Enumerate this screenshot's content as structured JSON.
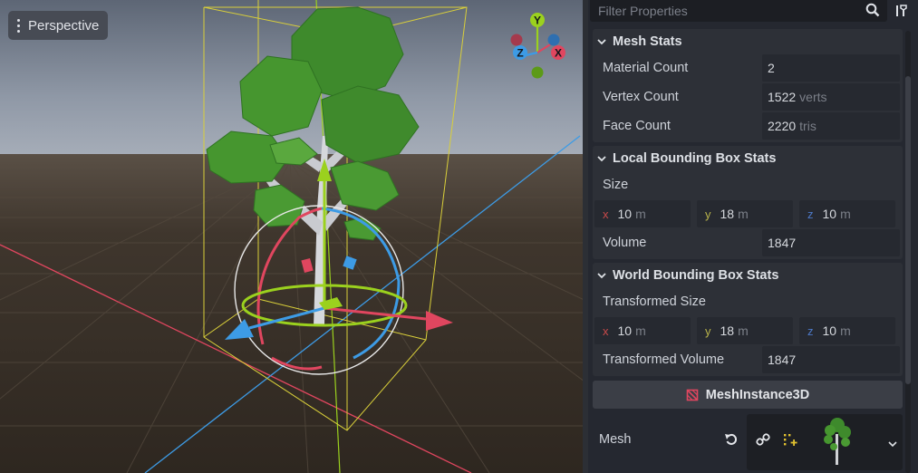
{
  "viewport": {
    "view_mode_label": "Perspective",
    "gizmo_axes": {
      "y": "Y",
      "z": "Z",
      "x": "X"
    }
  },
  "inspector": {
    "filter": {
      "placeholder": "Filter Properties"
    },
    "mesh_stats": {
      "title": "Mesh Stats",
      "rows": [
        {
          "label": "Material Count",
          "value": "2",
          "unit": ""
        },
        {
          "label": "Vertex Count",
          "value": "1522",
          "unit": "verts"
        },
        {
          "label": "Face Count",
          "value": "2220",
          "unit": "tris"
        }
      ]
    },
    "local_bbox": {
      "title": "Local Bounding Box Stats",
      "size_label": "Size",
      "size": {
        "x_axis": "x",
        "x": "10",
        "y_axis": "y",
        "y": "18",
        "z_axis": "z",
        "z": "10",
        "unit": "m"
      },
      "volume_label": "Volume",
      "volume": "1847"
    },
    "world_bbox": {
      "title": "World Bounding Box Stats",
      "size_label": "Transformed Size",
      "size": {
        "x_axis": "x",
        "x": "10",
        "y_axis": "y",
        "y": "18",
        "z_axis": "z",
        "z": "10",
        "unit": "m"
      },
      "volume_label": "Transformed Volume",
      "volume": "1847"
    },
    "component": {
      "title": "MeshInstance3D"
    },
    "mesh_property": {
      "label": "Mesh"
    }
  },
  "colors": {
    "axis_x": "#e0465f",
    "axis_y": "#9bd11e",
    "axis_z": "#3d9be5",
    "bbox": "#d9cf3a",
    "accent": "#e0465f"
  }
}
